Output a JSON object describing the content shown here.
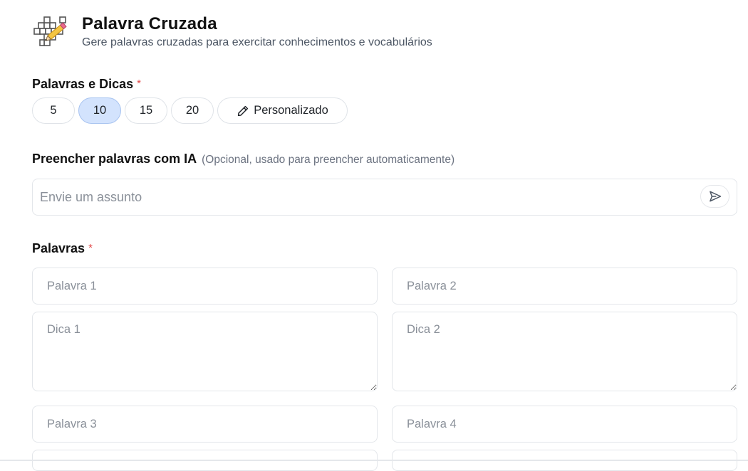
{
  "header": {
    "title": "Palavra Cruzada",
    "subtitle": "Gere palavras cruzadas para exercitar conhecimentos e vocabulários",
    "icon": "crossword-pencil-icon"
  },
  "words_and_hints": {
    "label": "Palavras e Dicas",
    "required_mark": "*",
    "options": [
      "5",
      "10",
      "15",
      "20"
    ],
    "selected": "10",
    "custom_label": "Personalizado",
    "custom_icon": "pencil-icon"
  },
  "ai_fill": {
    "label": "Preencher palavras com IA",
    "optional_note": "(Opcional, usado para preencher automaticamente)",
    "placeholder": "Envie um assunto",
    "send_icon": "send-icon"
  },
  "words": {
    "label": "Palavras",
    "required_mark": "*",
    "fields": [
      {
        "word_placeholder": "Palavra 1",
        "hint_placeholder": "Dica 1"
      },
      {
        "word_placeholder": "Palavra 2",
        "hint_placeholder": "Dica 2"
      },
      {
        "word_placeholder": "Palavra 3"
      },
      {
        "word_placeholder": "Palavra 4"
      }
    ]
  },
  "colors": {
    "selected_pill_bg": "#d3e3fd",
    "required_mark": "#e24b4b",
    "border": "#e3e6ea"
  }
}
